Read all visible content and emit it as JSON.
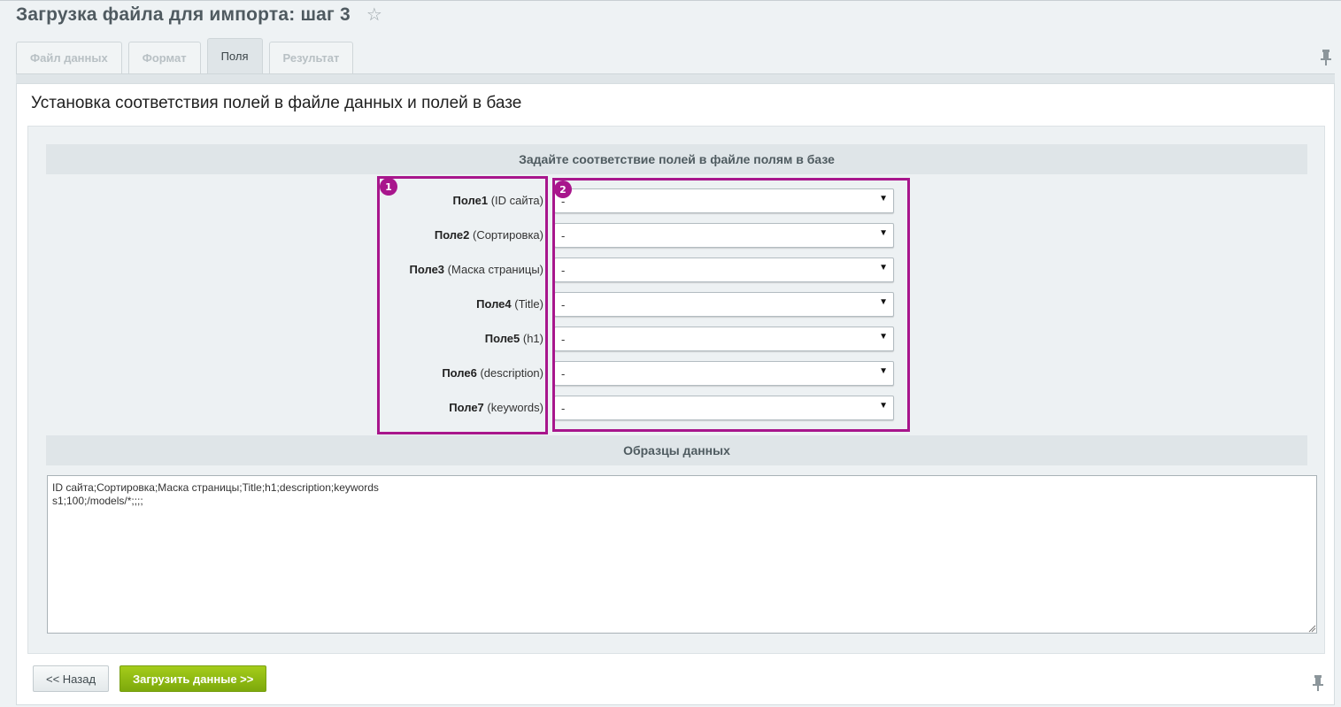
{
  "page": {
    "title": "Загрузка файла для импорта: шаг 3"
  },
  "tabs": [
    {
      "label": "Файл данных",
      "active": false
    },
    {
      "label": "Формат",
      "active": false
    },
    {
      "label": "Поля",
      "active": true
    },
    {
      "label": "Результат",
      "active": false
    }
  ],
  "panel": {
    "heading": "Установка соответствия полей в файле данных и полей в базе",
    "mapping_header": "Задайте соответствие полей в файле полям в базе",
    "samples_header": "Образцы данных",
    "fields": [
      {
        "name": "Поле1",
        "hint": "(ID сайта)",
        "value": "-"
      },
      {
        "name": "Поле2",
        "hint": "(Сортировка)",
        "value": "-"
      },
      {
        "name": "Поле3",
        "hint": "(Маска страницы)",
        "value": "-"
      },
      {
        "name": "Поле4",
        "hint": "(Title)",
        "value": "-"
      },
      {
        "name": "Поле5",
        "hint": "(h1)",
        "value": "-"
      },
      {
        "name": "Поле6",
        "hint": "(description)",
        "value": "-"
      },
      {
        "name": "Поле7",
        "hint": "(keywords)",
        "value": "-"
      }
    ],
    "sample_text": "ID сайта;Сортировка;Маска страницы;Title;h1;description;keywords\ns1;100;/models/*;;;;"
  },
  "annotations": {
    "badge1": "1",
    "badge2": "2",
    "color": "#a8168c"
  },
  "buttons": {
    "back": "<< Назад",
    "load": "Загрузить данные >>"
  },
  "colors": {
    "accent_green": "#8cb814",
    "highlight": "#a8168c"
  }
}
